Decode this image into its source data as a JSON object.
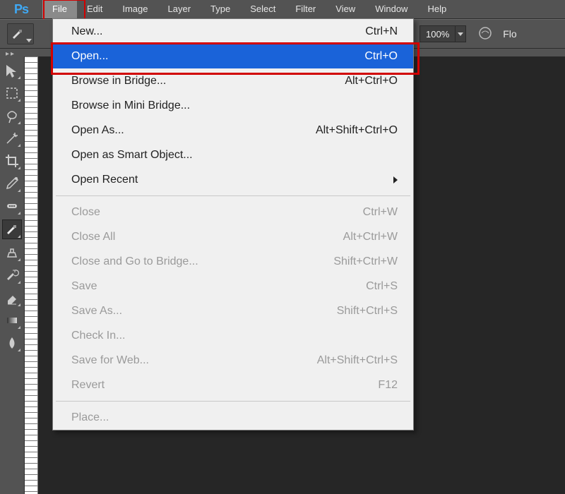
{
  "menubar": {
    "items": [
      "File",
      "Edit",
      "Image",
      "Layer",
      "Type",
      "Select",
      "Filter",
      "View",
      "Window",
      "Help"
    ],
    "open_index": 0
  },
  "options_bar": {
    "zoom": "100%",
    "right_label": "Flo"
  },
  "file_menu": {
    "groups": [
      [
        {
          "label": "New...",
          "shortcut": "Ctrl+N",
          "enabled": true
        },
        {
          "label": "Open...",
          "shortcut": "Ctrl+O",
          "enabled": true,
          "selected": true
        },
        {
          "label": "Browse in Bridge...",
          "shortcut": "Alt+Ctrl+O",
          "enabled": true
        },
        {
          "label": "Browse in Mini Bridge...",
          "shortcut": "",
          "enabled": true
        },
        {
          "label": "Open As...",
          "shortcut": "Alt+Shift+Ctrl+O",
          "enabled": true
        },
        {
          "label": "Open as Smart Object...",
          "shortcut": "",
          "enabled": true
        },
        {
          "label": "Open Recent",
          "shortcut": "",
          "enabled": true,
          "submenu": true
        }
      ],
      [
        {
          "label": "Close",
          "shortcut": "Ctrl+W",
          "enabled": false
        },
        {
          "label": "Close All",
          "shortcut": "Alt+Ctrl+W",
          "enabled": false
        },
        {
          "label": "Close and Go to Bridge...",
          "shortcut": "Shift+Ctrl+W",
          "enabled": false
        },
        {
          "label": "Save",
          "shortcut": "Ctrl+S",
          "enabled": false
        },
        {
          "label": "Save As...",
          "shortcut": "Shift+Ctrl+S",
          "enabled": false
        },
        {
          "label": "Check In...",
          "shortcut": "",
          "enabled": false
        },
        {
          "label": "Save for Web...",
          "shortcut": "Alt+Shift+Ctrl+S",
          "enabled": false
        },
        {
          "label": "Revert",
          "shortcut": "F12",
          "enabled": false
        }
      ],
      [
        {
          "label": "Place...",
          "shortcut": "",
          "enabled": false
        }
      ]
    ]
  },
  "tools": [
    {
      "name": "move-tool"
    },
    {
      "name": "marquee-tool"
    },
    {
      "name": "lasso-tool"
    },
    {
      "name": "magic-wand-tool"
    },
    {
      "name": "crop-tool"
    },
    {
      "name": "eyedropper-tool"
    },
    {
      "name": "healing-brush-tool"
    },
    {
      "name": "brush-tool",
      "active": true
    },
    {
      "name": "clone-stamp-tool"
    },
    {
      "name": "history-brush-tool"
    },
    {
      "name": "eraser-tool"
    },
    {
      "name": "gradient-tool"
    },
    {
      "name": "blur-tool"
    }
  ],
  "logo_text": "Ps"
}
